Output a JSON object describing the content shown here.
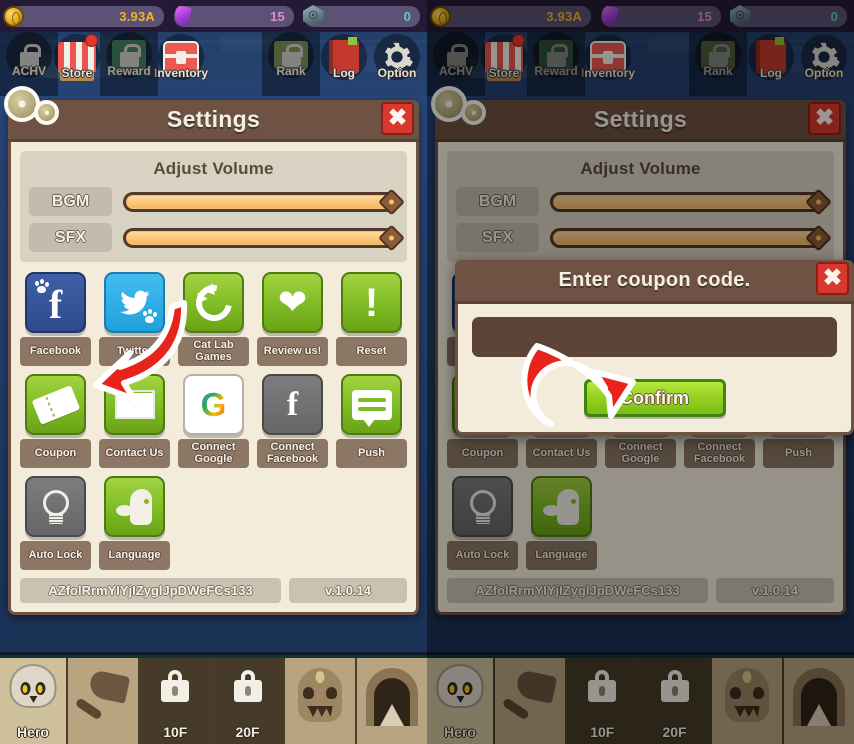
{
  "topbar": {
    "currencies": [
      {
        "name": "gold",
        "icon": "coin-icon",
        "value": "3.93A"
      },
      {
        "name": "gem",
        "icon": "gem-icon",
        "value": "15"
      },
      {
        "name": "soul",
        "icon": "soul-icon",
        "value": "0"
      }
    ]
  },
  "nav": {
    "items": [
      {
        "label": "ACHV",
        "icon": "achievement-icon",
        "dim": true,
        "badge": false
      },
      {
        "label": "Store",
        "icon": "store-icon",
        "dim": false,
        "badge": true
      },
      {
        "label": "Reward",
        "icon": "reward-icon",
        "dim": true,
        "badge": false
      },
      {
        "label": "Inventory",
        "icon": "inventory-icon",
        "dim": false,
        "badge": false
      },
      {
        "label": "Rank",
        "icon": "rank-icon",
        "dim": true,
        "badge": false
      },
      {
        "label": "Log",
        "icon": "log-icon",
        "dim": false,
        "badge": false
      },
      {
        "label": "Option",
        "icon": "gear-icon",
        "dim": false,
        "badge": false
      }
    ]
  },
  "settings": {
    "title": "Settings",
    "close_label": "✖",
    "volume": {
      "heading": "Adjust Volume",
      "rows": [
        {
          "label": "BGM",
          "value": 100
        },
        {
          "label": "SFX",
          "value": 100
        }
      ]
    },
    "buttons": [
      {
        "label": "Facebook",
        "icon": "facebook-icon",
        "style": "fb"
      },
      {
        "label": "Twitter",
        "icon": "twitter-icon",
        "style": "tw"
      },
      {
        "label": "Cat Lab\nGames",
        "icon": "cat-lab-icon",
        "style": "green"
      },
      {
        "label": "Review us!",
        "icon": "heart-icon",
        "style": "green"
      },
      {
        "label": "Reset",
        "icon": "exclamation-icon",
        "style": "green"
      },
      {
        "label": "Coupon",
        "icon": "ticket-icon",
        "style": "green"
      },
      {
        "label": "Contact Us",
        "icon": "envelope-icon",
        "style": "green"
      },
      {
        "label": "Connect\nGoogle",
        "icon": "google-icon",
        "style": "white"
      },
      {
        "label": "Connect\nFacebook",
        "icon": "facebook-mono-icon",
        "style": "gray"
      },
      {
        "label": "Push",
        "icon": "chat-bubble-icon",
        "style": "green"
      },
      {
        "label": "Auto Lock",
        "icon": "lightbulb-icon",
        "style": "gray"
      },
      {
        "label": "Language",
        "icon": "speech-head-icon",
        "style": "green"
      }
    ],
    "account_id": "AZfolRrmYIYjIZyglJpDWeFCs133",
    "version": "v.1.0.14"
  },
  "coupon_dialog": {
    "title": "Enter coupon code.",
    "close_label": "✖",
    "input_value": "",
    "input_placeholder": "",
    "confirm_label": "Confirm"
  },
  "hero_bar": {
    "cells": [
      {
        "label": "Hero",
        "icon": "skull-icon",
        "locked": false,
        "tone": "first"
      },
      {
        "label": "",
        "icon": "axe-icon",
        "locked": false,
        "tone": "light"
      },
      {
        "label": "10F",
        "icon": "lock-icon",
        "locked": true,
        "tone": "dark"
      },
      {
        "label": "20F",
        "icon": "lock-icon",
        "locked": true,
        "tone": "dark"
      },
      {
        "label": "",
        "icon": "mask-icon",
        "locked": false,
        "tone": "light"
      },
      {
        "label": "",
        "icon": "dungeon-door-icon",
        "locked": false,
        "tone": "light"
      }
    ]
  },
  "annotations": {
    "left_arrow": {
      "name": "arrow-to-coupon-button",
      "color": "#e8231c"
    },
    "right_arrow": {
      "name": "arrow-to-confirm-button",
      "color": "#e8231c"
    }
  },
  "colors": {
    "panel_bg": "#f3ecdb",
    "header_brown": "#6e5243",
    "accent_green": "#7ebb24",
    "danger_red": "#d7392e",
    "slider_fill": "#f4b863"
  }
}
